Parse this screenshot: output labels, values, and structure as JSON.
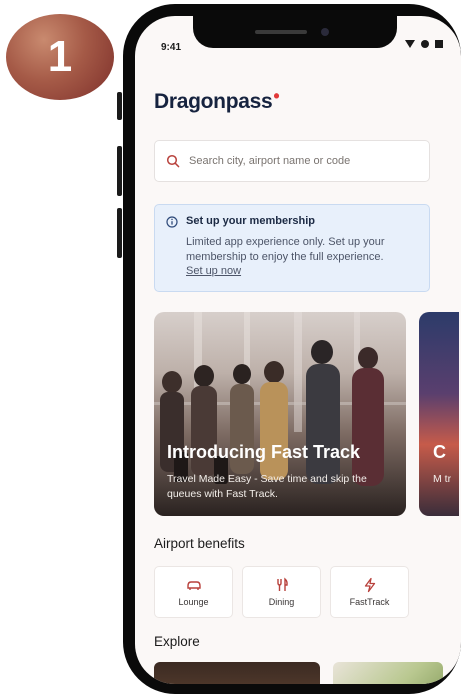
{
  "step": {
    "number": "1"
  },
  "status_bar": {
    "time": "9:41"
  },
  "brand": {
    "name": "Dragonpass",
    "dot": "•"
  },
  "search": {
    "placeholder": "Search city, airport name or code"
  },
  "membership_notice": {
    "title": "Set up your membership",
    "text": "Limited app experience only. Set up your membership to enjoy the full experience.",
    "link": "Set up now"
  },
  "carousel": [
    {
      "title": "Introducing Fast Track",
      "subtitle": "Travel Made Easy - Save time and skip the queues with Fast Track."
    },
    {
      "title": "C",
      "subtitle": "M tr"
    }
  ],
  "airport_benefits": {
    "title": "Airport benefits",
    "items": [
      {
        "label": "Lounge",
        "icon": "lounge-icon"
      },
      {
        "label": "Dining",
        "icon": "dining-icon"
      },
      {
        "label": "FastTrack",
        "icon": "fasttrack-icon"
      }
    ]
  },
  "explore": {
    "title": "Explore"
  },
  "colors": {
    "brand_navy": "#16233f",
    "accent_red": "#e23a3a",
    "icon_red": "#b8413c",
    "notice_bg": "#e8f0fb"
  }
}
